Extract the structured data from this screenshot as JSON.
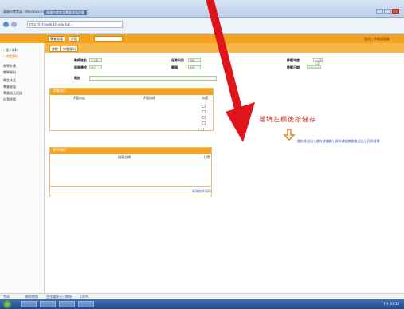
{
  "browser": {
    "window_title": "高雄市教育局 - Windows Internet Explorer",
    "tab_title": "高雄市教育局專業發展評鑑",
    "url": "http://tchrweb.kh.edu.tw/..."
  },
  "app": {
    "header_tabs": [
      "專業發展",
      "評鑑"
    ],
    "header_input": "",
    "user": "登出 | 系統管理員",
    "sub_tabs": [
      "評鑑",
      "評鑑資料"
    ]
  },
  "sidebar": {
    "items": [
      {
        "label": "› 個人資料",
        "active": false
      },
      {
        "label": "› 評鑑資料",
        "active": true
      },
      {
        "label": "教學計畫",
        "active": false
      },
      {
        "label": "教學資料",
        "active": false
      },
      {
        "label": "學生作品",
        "active": false
      },
      {
        "label": "專業發展",
        "active": false
      },
      {
        "label": "專業成長紀錄",
        "active": false
      },
      {
        "label": "自我評鑑",
        "active": false
      }
    ]
  },
  "form": {
    "fields": [
      {
        "label": "教師姓名",
        "value": "王小明"
      },
      {
        "label": "服務學校",
        "value": "國小"
      },
      {
        "label": "任教科目",
        "value": "國語"
      },
      {
        "label": "職稱",
        "value": "教師"
      },
      {
        "label": "評鑑年度",
        "value": "100學年度"
      },
      {
        "label": "評鑑日期",
        "value": "100/10/01"
      },
      {
        "label": "評鑑人員",
        "value": "審核"
      },
      {
        "label": "評鑑狀態",
        "value": "完成"
      },
      {
        "label": "備註",
        "value": ""
      }
    ]
  },
  "panel1": {
    "title": "評鑑項目",
    "columns": [
      "評鑑向度",
      "評鑑指標",
      "勾選"
    ],
    "footer": "1 / 1"
  },
  "panel2": {
    "title": "附件資料",
    "columns": [
      "檔案名稱",
      "上傳"
    ],
    "footer": "新增附件資料"
  },
  "annotation": {
    "text": "選填左欄後按儲存",
    "link": "儲存並送出 | 儲存並繼續 | 資料確認無誤後送出 | 回到清單"
  },
  "statusbar": [
    "完成",
    "網際網路",
    "受保護模式",
    "已關閉",
    "100%"
  ],
  "taskbar": {
    "clock": "下午 03:12"
  },
  "colors": {
    "accent": "#f4a21f",
    "annotation": "#c0392b",
    "arrow": "#e0141b"
  }
}
